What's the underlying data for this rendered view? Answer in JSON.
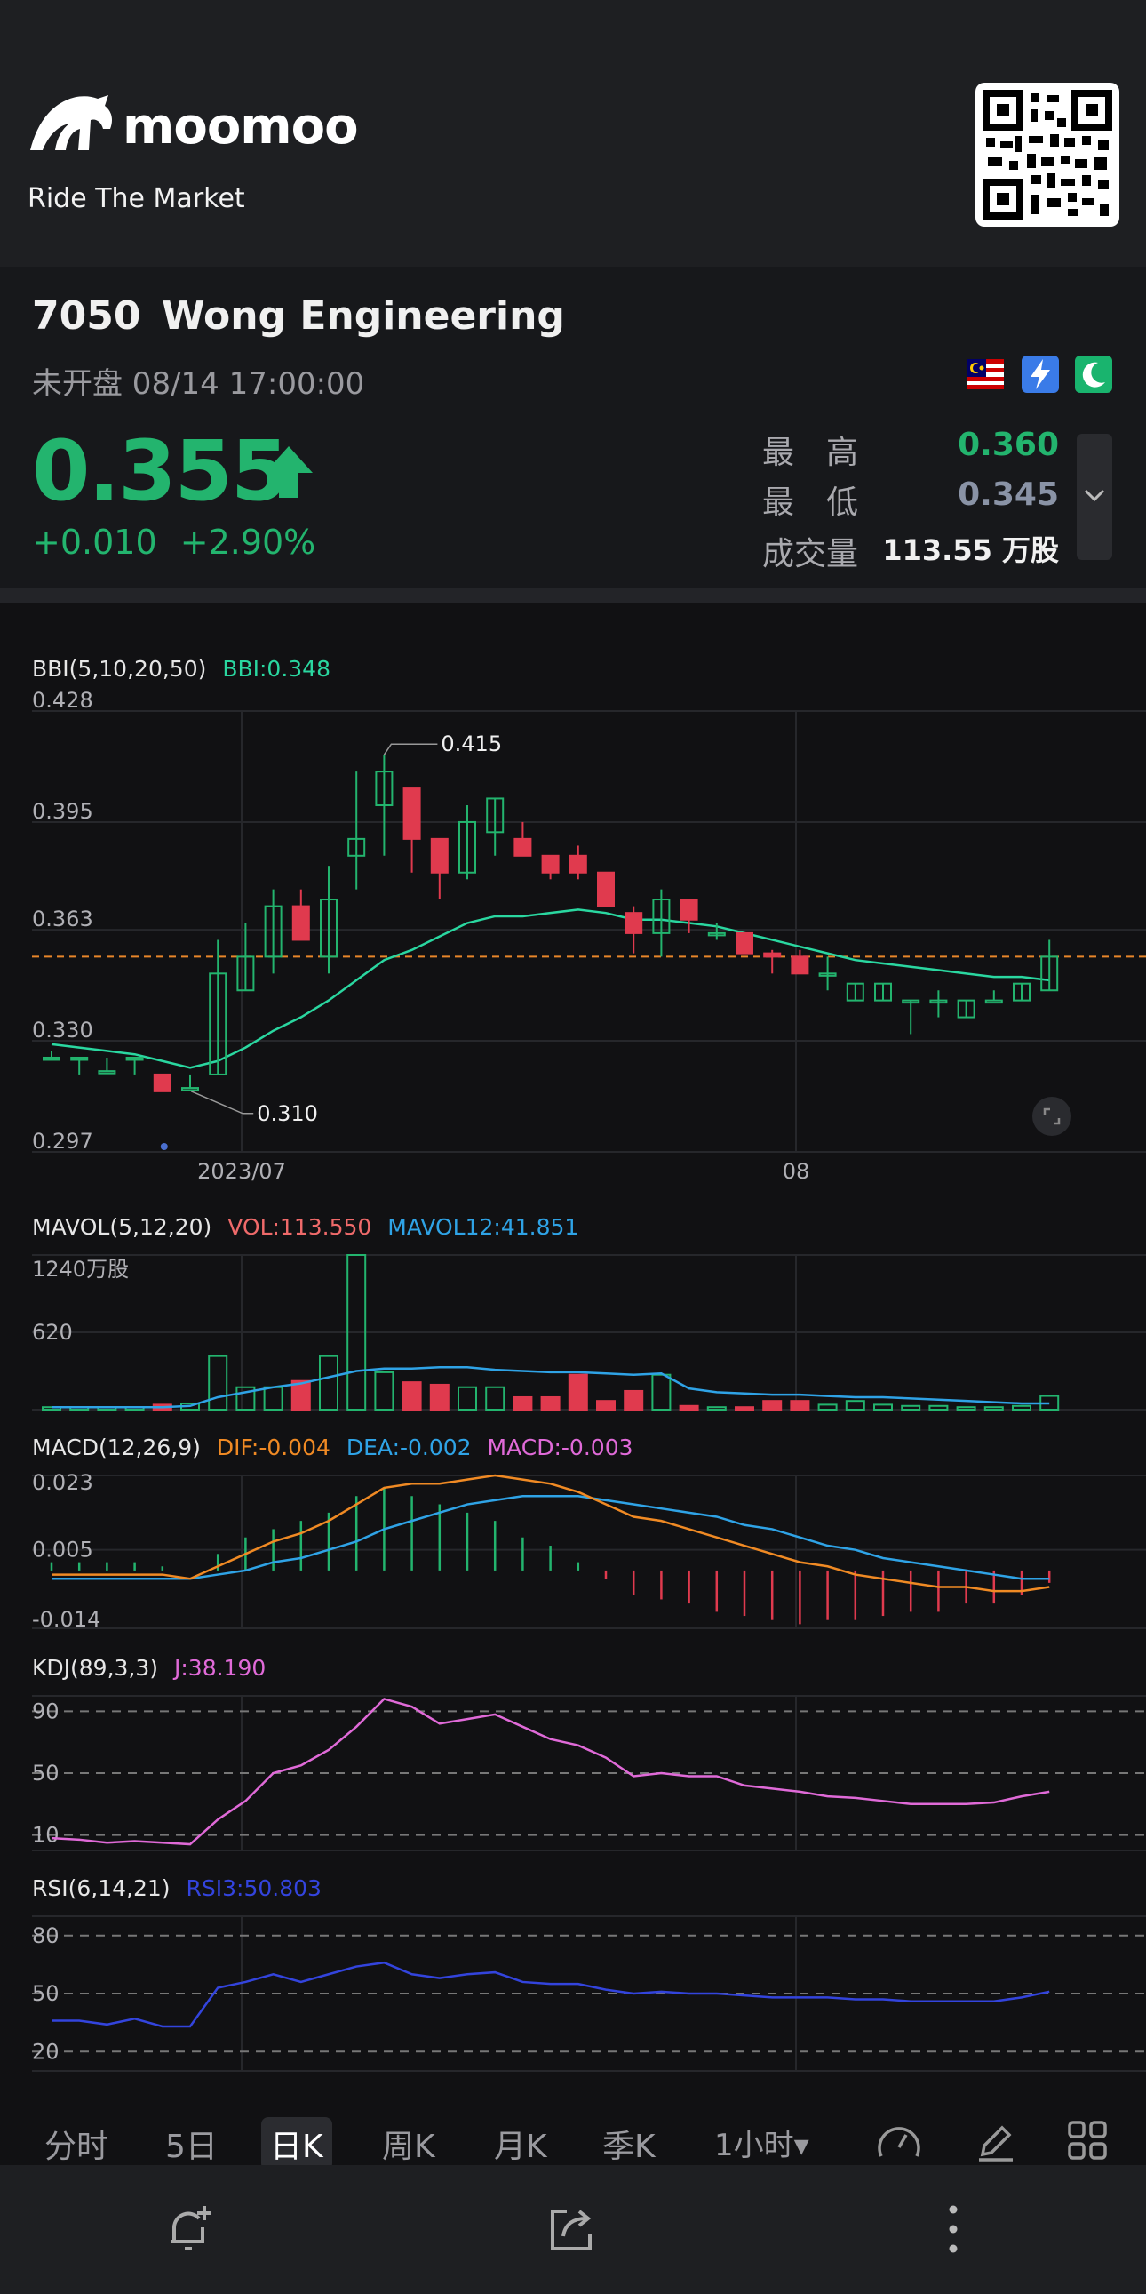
{
  "header": {
    "brand": "moomoo",
    "tagline": "Ride The Market"
  },
  "stock": {
    "code": "7050",
    "name": "Wong Engineering",
    "status": "未开盘 08/14 17:00:00",
    "price": "0.355",
    "change": "+0.010",
    "change_pct": "+2.90%",
    "high_label": "最　高",
    "high": "0.360",
    "low_label": "最　低",
    "low": "0.345",
    "volume_label": "成交量",
    "volume": "113.55 万股",
    "badges": [
      "malaysia-flag-icon",
      "lightning-icon",
      "moon-icon"
    ]
  },
  "colors": {
    "up": "#23b46e",
    "down": "#e03a4e",
    "bbi": "#2ad7a0",
    "dif": "#f08a24",
    "dea": "#2fa3e6",
    "macd": "#e06ad8",
    "kdj": "#e06ad8",
    "rsi": "#3344dd",
    "vol_label": "#ef6a6a"
  },
  "main_chart": {
    "indicator": "BBI(5,10,20,50)",
    "value": "BBI:0.348",
    "y_ticks": [
      "0.428",
      "0.395",
      "0.363",
      "0.330",
      "0.297"
    ],
    "x_ticks": [
      "2023/07",
      "08"
    ],
    "high_marker": "0.415",
    "low_marker": "0.310"
  },
  "vol_chart": {
    "indicator": "MAVOL(5,12,20)",
    "vol": "VOL:113.550",
    "mavol": "MAVOL12:41.851",
    "y_ticks": [
      "1240万股",
      "620"
    ]
  },
  "macd_chart": {
    "indicator": "MACD(12,26,9)",
    "dif": "DIF:-0.004",
    "dea": "DEA:-0.002",
    "macd": "MACD:-0.003",
    "y_ticks": [
      "0.023",
      "0.005",
      "-0.014"
    ]
  },
  "kdj_chart": {
    "indicator": "KDJ(89,3,3)",
    "j": "J:38.190",
    "y_ticks": [
      "90",
      "50",
      "10"
    ]
  },
  "rsi_chart": {
    "indicator": "RSI(6,14,21)",
    "rsi": "RSI3:50.803",
    "y_ticks": [
      "80",
      "50",
      "20"
    ]
  },
  "tabs": [
    "分时",
    "5日",
    "日K",
    "周K",
    "月K",
    "季K",
    "1小时▾"
  ],
  "active_tab": "日K",
  "chart_data": {
    "type": "candlestick",
    "ylim": [
      0.297,
      0.428
    ],
    "candles": [
      {
        "o": 0.325,
        "c": 0.325,
        "h": 0.327,
        "l": 0.325
      },
      {
        "o": 0.325,
        "c": 0.325,
        "h": 0.325,
        "l": 0.32
      },
      {
        "o": 0.321,
        "c": 0.321,
        "h": 0.325,
        "l": 0.321
      },
      {
        "o": 0.325,
        "c": 0.325,
        "h": 0.325,
        "l": 0.32
      },
      {
        "o": 0.32,
        "c": 0.315,
        "h": 0.32,
        "l": 0.315
      },
      {
        "o": 0.316,
        "c": 0.316,
        "h": 0.32,
        "l": 0.316
      },
      {
        "o": 0.32,
        "c": 0.35,
        "h": 0.36,
        "l": 0.32
      },
      {
        "o": 0.345,
        "c": 0.355,
        "h": 0.365,
        "l": 0.345
      },
      {
        "o": 0.355,
        "c": 0.37,
        "h": 0.375,
        "l": 0.35
      },
      {
        "o": 0.37,
        "c": 0.36,
        "h": 0.375,
        "l": 0.36
      },
      {
        "o": 0.355,
        "c": 0.372,
        "h": 0.382,
        "l": 0.35
      },
      {
        "o": 0.385,
        "c": 0.39,
        "h": 0.41,
        "l": 0.375
      },
      {
        "o": 0.4,
        "c": 0.41,
        "h": 0.415,
        "l": 0.385
      },
      {
        "o": 0.405,
        "c": 0.39,
        "h": 0.405,
        "l": 0.38
      },
      {
        "o": 0.39,
        "c": 0.38,
        "h": 0.39,
        "l": 0.372
      },
      {
        "o": 0.38,
        "c": 0.395,
        "h": 0.4,
        "l": 0.378
      },
      {
        "o": 0.392,
        "c": 0.402,
        "h": 0.402,
        "l": 0.385
      },
      {
        "o": 0.39,
        "c": 0.385,
        "h": 0.395,
        "l": 0.385
      },
      {
        "o": 0.385,
        "c": 0.38,
        "h": 0.385,
        "l": 0.378
      },
      {
        "o": 0.385,
        "c": 0.38,
        "h": 0.388,
        "l": 0.378
      },
      {
        "o": 0.38,
        "c": 0.37,
        "h": 0.38,
        "l": 0.37
      },
      {
        "o": 0.368,
        "c": 0.362,
        "h": 0.37,
        "l": 0.356
      },
      {
        "o": 0.362,
        "c": 0.372,
        "h": 0.375,
        "l": 0.355
      },
      {
        "o": 0.372,
        "c": 0.366,
        "h": 0.372,
        "l": 0.362
      },
      {
        "o": 0.362,
        "c": 0.362,
        "h": 0.365,
        "l": 0.36
      },
      {
        "o": 0.362,
        "c": 0.356,
        "h": 0.362,
        "l": 0.356
      },
      {
        "o": 0.356,
        "c": 0.355,
        "h": 0.357,
        "l": 0.35
      },
      {
        "o": 0.355,
        "c": 0.35,
        "h": 0.357,
        "l": 0.35
      },
      {
        "o": 0.35,
        "c": 0.35,
        "h": 0.355,
        "l": 0.345
      },
      {
        "o": 0.342,
        "c": 0.347,
        "h": 0.347,
        "l": 0.342
      },
      {
        "o": 0.342,
        "c": 0.347,
        "h": 0.347,
        "l": 0.342
      },
      {
        "o": 0.342,
        "c": 0.342,
        "h": 0.342,
        "l": 0.332
      },
      {
        "o": 0.342,
        "c": 0.342,
        "h": 0.345,
        "l": 0.337
      },
      {
        "o": 0.337,
        "c": 0.342,
        "h": 0.342,
        "l": 0.337
      },
      {
        "o": 0.342,
        "c": 0.342,
        "h": 0.345,
        "l": 0.342
      },
      {
        "o": 0.342,
        "c": 0.347,
        "h": 0.347,
        "l": 0.342
      },
      {
        "o": 0.345,
        "c": 0.355,
        "h": 0.36,
        "l": 0.345
      }
    ],
    "bbi": [
      0.329,
      0.328,
      0.327,
      0.326,
      0.324,
      0.322,
      0.324,
      0.328,
      0.333,
      0.337,
      0.342,
      0.348,
      0.354,
      0.357,
      0.361,
      0.365,
      0.367,
      0.367,
      0.368,
      0.369,
      0.368,
      0.366,
      0.366,
      0.365,
      0.364,
      0.362,
      0.36,
      0.358,
      0.356,
      0.354,
      0.353,
      0.352,
      0.351,
      0.35,
      0.349,
      0.349,
      0.348
    ],
    "volume": [
      0.2,
      0.2,
      0.2,
      0.2,
      0.4,
      0.5,
      4.3,
      1.8,
      1.8,
      2.3,
      4.3,
      12.4,
      3.0,
      2.2,
      2.0,
      1.8,
      1.8,
      1.0,
      1.0,
      2.8,
      0.7,
      1.5,
      2.8,
      0.3,
      0.2,
      0.2,
      0.7,
      0.7,
      0.4,
      0.7,
      0.4,
      0.3,
      0.3,
      0.2,
      0.2,
      0.3,
      1.1
    ],
    "mavol": [
      0.2,
      0.2,
      0.2,
      0.2,
      0.2,
      0.3,
      1.0,
      1.4,
      1.8,
      2.1,
      2.6,
      3.1,
      3.3,
      3.3,
      3.4,
      3.4,
      3.2,
      3.1,
      3.0,
      3.0,
      2.9,
      2.8,
      2.9,
      1.7,
      1.4,
      1.3,
      1.2,
      1.2,
      1.1,
      1.0,
      1.0,
      0.9,
      0.8,
      0.7,
      0.6,
      0.5,
      0.5
    ],
    "vol_ylim": [
      0,
      12.4
    ],
    "macd": {
      "ylim": [
        -0.014,
        0.023
      ],
      "dif": [
        -0.001,
        -0.001,
        -0.001,
        -0.001,
        -0.001,
        -0.002,
        0.001,
        0.004,
        0.007,
        0.009,
        0.012,
        0.016,
        0.02,
        0.021,
        0.021,
        0.022,
        0.023,
        0.022,
        0.021,
        0.019,
        0.016,
        0.013,
        0.012,
        0.01,
        0.008,
        0.006,
        0.004,
        0.002,
        0.001,
        -0.001,
        -0.002,
        -0.003,
        -0.004,
        -0.004,
        -0.005,
        -0.005,
        -0.004
      ],
      "dea": [
        -0.002,
        -0.002,
        -0.002,
        -0.002,
        -0.002,
        -0.002,
        -0.001,
        0.0,
        0.002,
        0.003,
        0.005,
        0.007,
        0.01,
        0.012,
        0.014,
        0.016,
        0.017,
        0.018,
        0.018,
        0.018,
        0.017,
        0.016,
        0.015,
        0.014,
        0.013,
        0.011,
        0.01,
        0.008,
        0.006,
        0.005,
        0.003,
        0.002,
        0.001,
        0.0,
        -0.001,
        -0.002,
        -0.002
      ],
      "hist": [
        0.002,
        0.002,
        0.002,
        0.002,
        0.001,
        0.0,
        0.004,
        0.008,
        0.01,
        0.012,
        0.014,
        0.018,
        0.02,
        0.018,
        0.016,
        0.014,
        0.012,
        0.008,
        0.006,
        0.002,
        -0.002,
        -0.006,
        -0.007,
        -0.008,
        -0.01,
        -0.011,
        -0.012,
        -0.013,
        -0.012,
        -0.012,
        -0.011,
        -0.01,
        -0.01,
        -0.008,
        -0.008,
        -0.006,
        -0.003
      ]
    },
    "kdj": {
      "ylim": [
        0,
        100
      ],
      "j": [
        8,
        7,
        5,
        6,
        5,
        4,
        20,
        32,
        50,
        55,
        65,
        80,
        98,
        93,
        82,
        85,
        88,
        80,
        72,
        68,
        60,
        48,
        50,
        48,
        48,
        42,
        40,
        38,
        35,
        34,
        32,
        30,
        30,
        30,
        31,
        35,
        38
      ]
    },
    "rsi": {
      "ylim": [
        10,
        90
      ],
      "rsi3": [
        36,
        36,
        34,
        37,
        33,
        33,
        53,
        56,
        60,
        56,
        60,
        64,
        66,
        60,
        58,
        60,
        61,
        56,
        55,
        55,
        52,
        50,
        51,
        50,
        50,
        49,
        48,
        48,
        48,
        47,
        47,
        46,
        46,
        46,
        46,
        48,
        51
      ]
    }
  }
}
